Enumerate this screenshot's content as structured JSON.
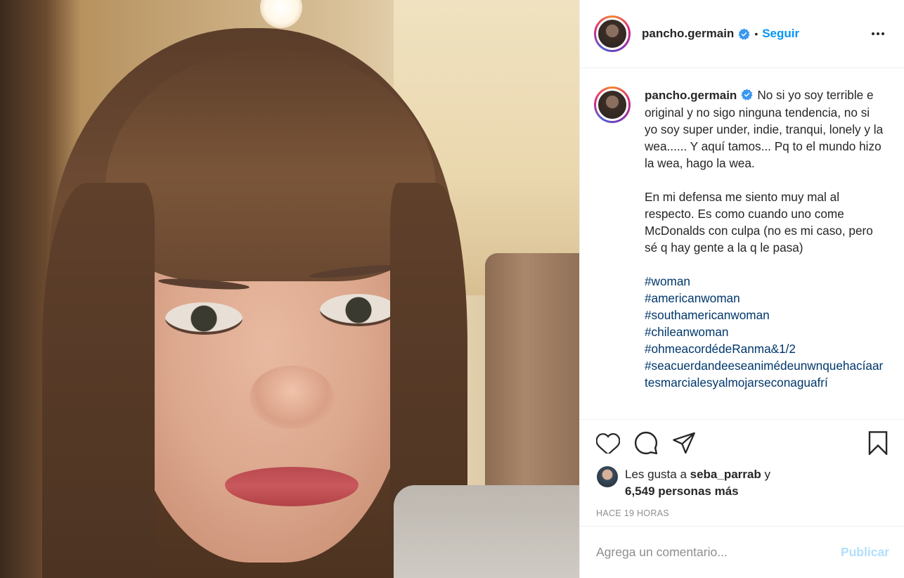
{
  "post": {
    "author": "pancho.germain",
    "verified": true,
    "separator": "•",
    "follow_label": "Seguir",
    "more_icon": "more-options-icon",
    "caption": {
      "author": "pancho.germain",
      "paragraph1": "No si yo soy terrible e original y no sigo ninguna tendencia, no si yo soy super under, indie, tranqui, lonely y la wea...... Y aquí tamos... Pq to el mundo hizo la wea, hago la wea.",
      "paragraph2": "En mi defensa me siento muy mal al respecto. Es como cuando uno come McDonalds con culpa (no es mi caso, pero sé q hay gente a la q le pasa)",
      "hashtags": [
        "#woman",
        "#americanwoman",
        "#southamericanwoman",
        "#chileanwoman",
        "#ohmeacordédeRanma&1/2",
        "#seacuerdandeeseaniméde​unwnquehacíaartesmarcialesyalmojarseconaguafrí"
      ]
    },
    "actions": {
      "like_icon": "heart-icon",
      "comment_icon": "comment-icon",
      "share_icon": "share-icon",
      "save_icon": "bookmark-icon"
    },
    "likes": {
      "prefix": "Les gusta a",
      "user": "seba_parrab",
      "conjunction": "y",
      "count_text": "6,549 personas más"
    },
    "timestamp": "HACE 19 HORAS",
    "comment": {
      "placeholder": "Agrega un comentario...",
      "publish_label": "Publicar"
    }
  },
  "colors": {
    "link": "#0095f6",
    "hashtag": "#00376b",
    "publish_disabled": "#b2dffc",
    "muted": "#8e8e8e"
  }
}
